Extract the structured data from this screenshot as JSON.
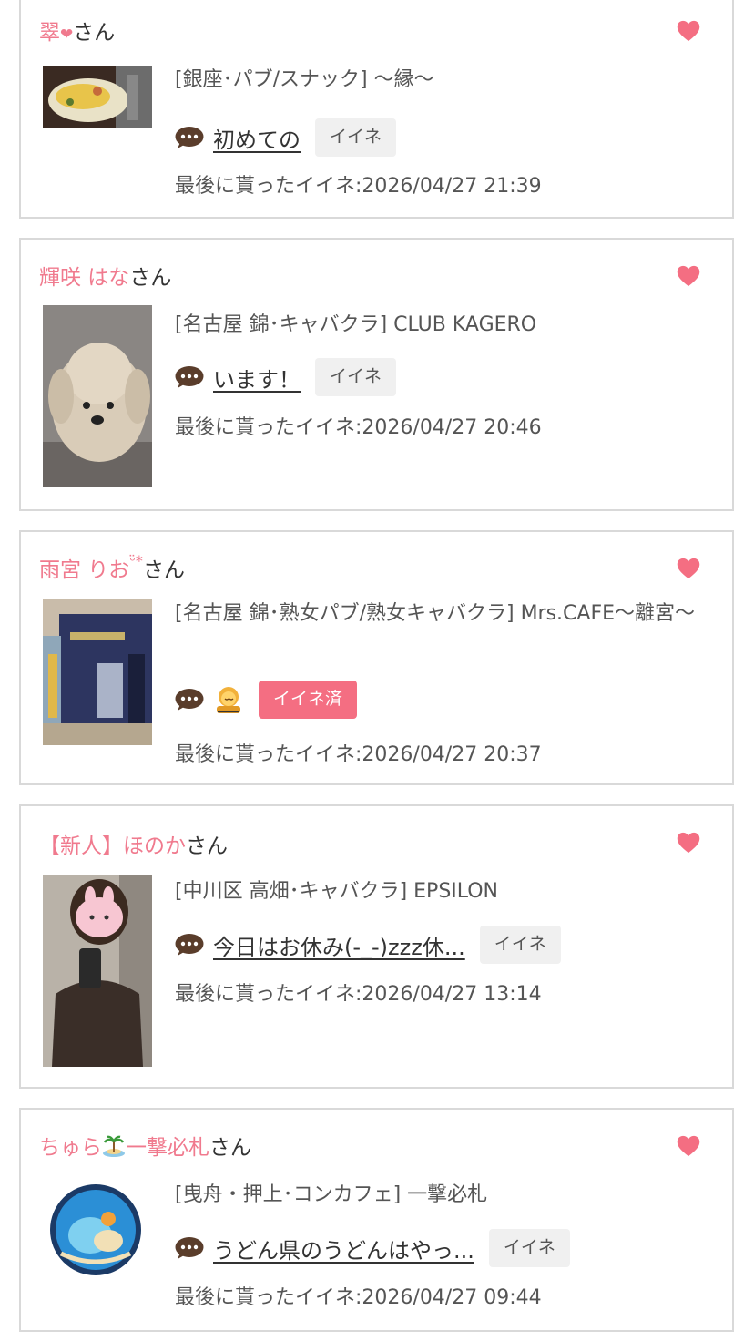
{
  "cards": [
    {
      "name": "翠",
      "name_emoji": "❤",
      "suffix": "さん",
      "shop": "[銀座･パブ/スナック] 〜縁〜",
      "message": "初めての",
      "button": "イイネ",
      "button_state": "default",
      "last_like": "最後に貰ったイイネ:2026/04/27 21:39"
    },
    {
      "name": "輝咲 はな",
      "suffix": "さん",
      "shop": "[名古屋 錦･キャバクラ] CLUB KAGERO",
      "message": "います！",
      "button": "イイネ",
      "button_state": "default",
      "last_like": "最後に貰ったイイネ:2026/04/27 20:46"
    },
    {
      "name": "雨宮 りお",
      "name_emoji": "ᵕ̈*",
      "suffix": "さん",
      "shop": "[名古屋 錦･熟女パブ/熟女キャバクラ] Mrs.CAFE〜離宮〜",
      "message_icon": "woman-gesturing-emoji",
      "button": "イイネ済",
      "button_state": "liked",
      "last_like": "最後に貰ったイイネ:2026/04/27 20:37"
    },
    {
      "name": "【新人】ほのか",
      "suffix": "さん",
      "shop": "[中川区 高畑･キャバクラ] EPSILON",
      "message": "今日はお休み(-_-)zzz休...",
      "button": "イイネ",
      "button_state": "default",
      "last_like": "最後に貰ったイイネ:2026/04/27 13:14"
    },
    {
      "name": "ちゅら",
      "name_emoji": "🏝",
      "name_after": "一撃必札",
      "suffix": "さん",
      "shop": "[曳舟・押上･コンカフェ] 一撃必札",
      "message": "うどん県のうどんはやっ...",
      "button": "イイネ",
      "button_state": "default",
      "last_like": "最後に貰ったイイネ:2026/04/27 09:44"
    }
  ],
  "colors": {
    "accent": "#f46e82",
    "name": "#f07a8e",
    "border": "#d9d9d9"
  },
  "icons": [
    "heart-icon",
    "speech-bubble-icon"
  ]
}
